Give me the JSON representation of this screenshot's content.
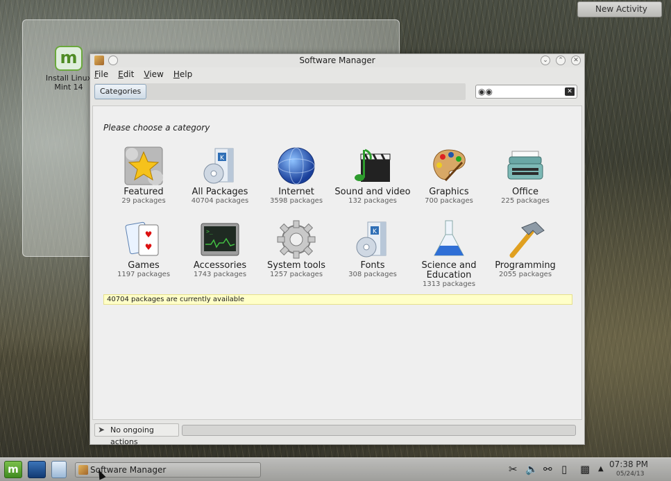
{
  "desktop": {
    "icon_label": "Install Linux Mint 14",
    "new_activity": "New Activity"
  },
  "window": {
    "title": "Software Manager",
    "menus": [
      {
        "pre": "",
        "u": "F",
        "post": "ile"
      },
      {
        "pre": "",
        "u": "E",
        "post": "dit"
      },
      {
        "pre": "",
        "u": "V",
        "post": "iew"
      },
      {
        "pre": "",
        "u": "H",
        "post": "elp"
      }
    ],
    "breadcrumb": "Categories",
    "search_placeholder": "",
    "heading": "Please choose a category",
    "categories": [
      {
        "name": "Featured",
        "count": "29 packages"
      },
      {
        "name": "All Packages",
        "count": "40704 packages"
      },
      {
        "name": "Internet",
        "count": "3598 packages"
      },
      {
        "name": "Sound and video",
        "count": "132 packages"
      },
      {
        "name": "Graphics",
        "count": "700 packages"
      },
      {
        "name": "Office",
        "count": "225 packages"
      },
      {
        "name": "Games",
        "count": "1197 packages"
      },
      {
        "name": "Accessories",
        "count": "1743 packages"
      },
      {
        "name": "System tools",
        "count": "1257 packages"
      },
      {
        "name": "Fonts",
        "count": "308 packages"
      },
      {
        "name": "Science and Education",
        "count": "1313 packages"
      },
      {
        "name": "Programming",
        "count": "2055 packages"
      }
    ],
    "available_status": "40704 packages are currently available",
    "action_status": "No ongoing actions"
  },
  "taskbar": {
    "task_label": "Software Manager",
    "time": "07:38 PM",
    "date": "05/24/13"
  },
  "colors": {
    "status_highlight": "#ffffc8",
    "accent": "#6aa83c"
  }
}
